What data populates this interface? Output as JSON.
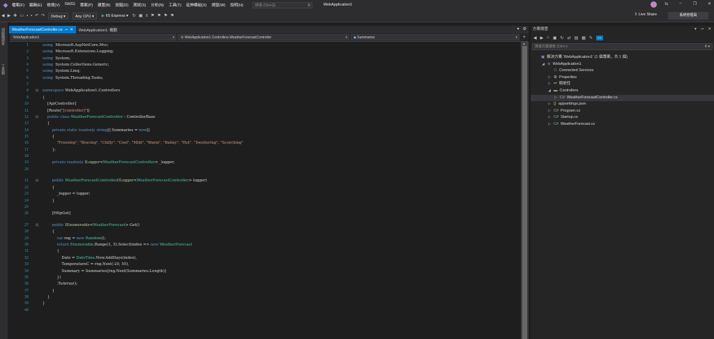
{
  "menu": {
    "items": [
      "檔案(F)",
      "編輯(E)",
      "檢視(V)",
      "Git(G)",
      "專案(P)",
      "建置(B)",
      "偵錯(D)",
      "測試(S)",
      "分析(N)",
      "工具(T)",
      "延伸模組(X)",
      "視窗(W)",
      "說明(H)"
    ],
    "search_placeholder": "搜尋 (Ctrl+Q)",
    "app_title": "WebApplication1"
  },
  "toolbar": {
    "config": "Debug",
    "platform": "Any CPU",
    "run_target": "IIS Express",
    "live_share": "Live Share",
    "admin": "系統管理員"
  },
  "editor": {
    "tabs": [
      {
        "label": "WeatherForecastController.cs",
        "active": true
      },
      {
        "label": "WebApplication1: 概觀",
        "active": false
      }
    ],
    "nav": {
      "project": "WebApplication1",
      "class": "WebApplication1.Controllers.WeatherForecastController",
      "member": "Summaries"
    },
    "lines": [
      {
        "n": 1,
        "y": 0,
        "tokens": [
          [
            "k",
            "using"
          ],
          [
            "",
            "  Microsoft.AspNetCore.Mvc;"
          ]
        ]
      },
      {
        "n": 2,
        "y": 1,
        "tokens": [
          [
            "k",
            "using"
          ],
          [
            "",
            "  Microsoft.Extensions.Logging;"
          ]
        ]
      },
      {
        "n": 3,
        "y": 2,
        "tokens": [
          [
            "k",
            "using"
          ],
          [
            "",
            "  System;"
          ]
        ]
      },
      {
        "n": 4,
        "y": 3,
        "tokens": [
          [
            "k",
            "using"
          ],
          [
            "",
            "  System.Collections.Generic;"
          ]
        ]
      },
      {
        "n": 5,
        "y": 4,
        "tokens": [
          [
            "k",
            "using"
          ],
          [
            "",
            "  System.Linq;"
          ]
        ]
      },
      {
        "n": 6,
        "y": 5,
        "tokens": [
          [
            "k",
            "using"
          ],
          [
            "",
            "  System.Threading.Tasks;"
          ]
        ]
      },
      {
        "n": 7,
        "y": 6,
        "tokens": []
      },
      {
        "n": 8,
        "y": 7,
        "tokens": [
          [
            "k",
            "namespace"
          ],
          [
            "",
            " WebApplication1.Controllers"
          ]
        ]
      },
      {
        "n": 9,
        "y": 8,
        "tokens": [
          [
            "",
            "{"
          ]
        ]
      },
      {
        "n": 10,
        "y": 9,
        "tokens": [
          [
            "",
            "    [ApiController]"
          ]
        ]
      },
      {
        "n": 11,
        "y": 10,
        "tokens": [
          [
            "",
            "    [Route("
          ],
          [
            "s",
            "\"[controller]\""
          ],
          [
            "",
            ")]"
          ]
        ]
      },
      {
        "n": 12,
        "y": 11,
        "tokens": [
          [
            "k",
            "    public class"
          ],
          [
            "t",
            " WeatherForecastController"
          ],
          [
            "",
            " : ControllerBase"
          ]
        ]
      },
      {
        "n": 13,
        "y": 12,
        "tokens": [
          [
            "",
            "    {"
          ]
        ]
      },
      {
        "n": 14,
        "y": 13,
        "tokens": [
          [
            "k",
            "        private static readonly string"
          ],
          [
            "",
            "[] Summaries = "
          ],
          [
            "k",
            "new"
          ],
          [
            "",
            "[]"
          ]
        ]
      },
      {
        "n": 15,
        "y": 14,
        "tokens": [
          [
            "",
            "        {"
          ]
        ]
      },
      {
        "n": 16,
        "y": 15,
        "tokens": [
          [
            "s",
            "            \"Freezing\", \"Bracing\", \"Chilly\", \"Cool\", \"Mild\", \"Warm\", \"Balmy\", \"Hot\", \"Sweltering\", \"Scorching\""
          ]
        ]
      },
      {
        "n": 17,
        "y": 16,
        "tokens": [
          [
            "",
            "        };"
          ]
        ]
      },
      {
        "n": 18,
        "y": 17,
        "tokens": []
      },
      {
        "n": 19,
        "y": 18,
        "tokens": [
          [
            "k",
            "        private readonly"
          ],
          [
            "i",
            " ILogger"
          ],
          [
            "",
            "<"
          ],
          [
            "t",
            "WeatherForecastController"
          ],
          [
            "",
            "> _logger;"
          ]
        ]
      },
      {
        "n": 20,
        "y": 19,
        "tokens": []
      },
      {
        "n": 21,
        "y": 20.8,
        "tokens": [
          [
            "k",
            "        public"
          ],
          [
            "t",
            " WeatherForecastController"
          ],
          [
            "",
            "("
          ],
          [
            "i",
            "ILogger"
          ],
          [
            "",
            "<"
          ],
          [
            "t",
            "WeatherForecastController"
          ],
          [
            "",
            "> logger)"
          ]
        ]
      },
      {
        "n": 22,
        "y": 21.8,
        "tokens": [
          [
            "",
            "        {"
          ]
        ]
      },
      {
        "n": 23,
        "y": 22.8,
        "tokens": [
          [
            "",
            "            _logger = logger;"
          ]
        ]
      },
      {
        "n": 24,
        "y": 23.8,
        "tokens": [
          [
            "",
            "        }"
          ]
        ]
      },
      {
        "n": 25,
        "y": 24.8,
        "tokens": []
      },
      {
        "n": 26,
        "y": 25.8,
        "tokens": [
          [
            "",
            "        [HttpGet]"
          ]
        ]
      },
      {
        "n": 27,
        "y": 27.6,
        "tokens": [
          [
            "k",
            "        public"
          ],
          [
            "i",
            " IEnumerable"
          ],
          [
            "",
            "<"
          ],
          [
            "t",
            "WeatherForecast"
          ],
          [
            "",
            "> Get()"
          ]
        ]
      },
      {
        "n": 28,
        "y": 28.6,
        "tokens": [
          [
            "",
            "        {"
          ]
        ]
      },
      {
        "n": 29,
        "y": 29.6,
        "tokens": [
          [
            "k",
            "            var"
          ],
          [
            "",
            " rng = "
          ],
          [
            "k",
            "new"
          ],
          [
            "t",
            " Random"
          ],
          [
            "",
            "();"
          ]
        ]
      },
      {
        "n": 30,
        "y": 30.6,
        "tokens": [
          [
            "k",
            "            return"
          ],
          [
            "t",
            " Enumerable"
          ],
          [
            "",
            ".Range(1, 5).Select(index => "
          ],
          [
            "k",
            "new"
          ],
          [
            "t",
            " WeatherForecast"
          ]
        ]
      },
      {
        "n": 31,
        "y": 31.6,
        "tokens": [
          [
            "",
            "            {"
          ]
        ]
      },
      {
        "n": 32,
        "y": 32.6,
        "tokens": [
          [
            "",
            "                Date = "
          ],
          [
            "t",
            "DateTime"
          ],
          [
            "",
            ".Now.AddDays(index),"
          ]
        ]
      },
      {
        "n": 33,
        "y": 33.6,
        "tokens": [
          [
            "",
            "                TemperatureC = rng.Next(-20, 55),"
          ]
        ]
      },
      {
        "n": 34,
        "y": 34.6,
        "tokens": [
          [
            "",
            "                Summary = Summaries[rng.Next(Summaries.Length)]"
          ]
        ]
      },
      {
        "n": 35,
        "y": 35.6,
        "tokens": [
          [
            "",
            "            })"
          ]
        ]
      },
      {
        "n": 36,
        "y": 36.6,
        "tokens": [
          [
            "",
            "            .ToArray();"
          ]
        ]
      },
      {
        "n": 37,
        "y": 37.6,
        "tokens": [
          [
            "",
            "        }"
          ]
        ]
      },
      {
        "n": 38,
        "y": 38.6,
        "tokens": [
          [
            "",
            "    }"
          ]
        ]
      },
      {
        "n": 39,
        "y": 39.6,
        "tokens": [
          [
            "",
            "}"
          ]
        ]
      },
      {
        "n": 40,
        "y": 40.6,
        "tokens": []
      }
    ]
  },
  "solution_explorer": {
    "title": "方案總管",
    "search_placeholder": "搜尋方案總管 (Ctrl+;)",
    "nodes": [
      {
        "label": "解決方案 'WebApplication1' (1 個專案，共 1 個)",
        "depth": 0,
        "twisty": "",
        "icon": "▣",
        "icon_class": "ic-sln",
        "name": "tree-node-solution"
      },
      {
        "label": "WebApplication1",
        "depth": 1,
        "twisty": "◢",
        "icon": "⊕",
        "icon_class": "ic-proj",
        "name": "tree-node-project"
      },
      {
        "label": "Connected Services",
        "depth": 2,
        "twisty": "",
        "icon": "⚇",
        "icon_class": "ic-conn",
        "name": "tree-node-connected-services"
      },
      {
        "label": "Properties",
        "depth": 2,
        "twisty": "▷",
        "icon": "⚙",
        "icon_class": "ic-gear",
        "name": "tree-node-properties"
      },
      {
        "label": "相依性",
        "depth": 2,
        "twisty": "▷",
        "icon": "⚯",
        "icon_class": "ic-ref",
        "name": "tree-node-dependencies"
      },
      {
        "label": "Controllers",
        "depth": 2,
        "twisty": "◢",
        "icon": "▬",
        "icon_class": "ic-folder",
        "name": "tree-node-controllers"
      },
      {
        "label": "WeatherForecastController.cs",
        "depth": 3,
        "twisty": "▷",
        "icon": "C#",
        "icon_class": "ic-cs2",
        "name": "tree-node-weatherforecastcontroller",
        "selected": true
      },
      {
        "label": "appsettings.json",
        "depth": 2,
        "twisty": "▷",
        "icon": "{}",
        "icon_class": "ic-json",
        "name": "tree-node-appsettings"
      },
      {
        "label": "Program.cs",
        "depth": 2,
        "twisty": "▷",
        "icon": "C#",
        "icon_class": "ic-cs2",
        "name": "tree-node-program"
      },
      {
        "label": "Startup.cs",
        "depth": 2,
        "twisty": "▷",
        "icon": "C#",
        "icon_class": "ic-cs2",
        "name": "tree-node-startup"
      },
      {
        "label": "WeatherForecast.cs",
        "depth": 2,
        "twisty": "▷",
        "icon": "C#",
        "icon_class": "ic-cs2",
        "name": "tree-node-weatherforecast"
      }
    ]
  },
  "colors": {
    "accent": "#007acc",
    "keyword": "#569cd6",
    "type": "#4ec9b0",
    "string": "#d69d85",
    "line_number": "#2b91af"
  }
}
